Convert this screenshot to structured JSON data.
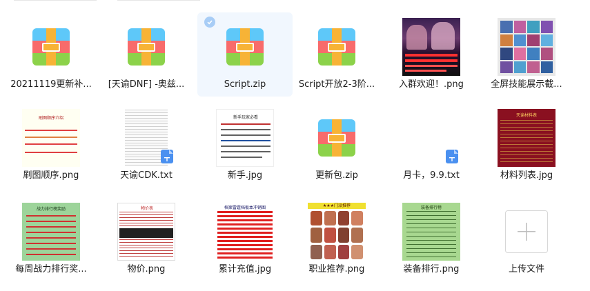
{
  "files": [
    {
      "id": "zip1",
      "name": "20211119更新补丁.zip",
      "display": "20211119更新补...",
      "kind": "zip",
      "selected": false
    },
    {
      "id": "zip2",
      "name": "[天谕DNF] -奥兹.zip",
      "display": "[天谕DNF] -奥兹...",
      "kind": "zip",
      "selected": false
    },
    {
      "id": "zip3",
      "name": "Script.zip",
      "display": "Script.zip",
      "kind": "zip",
      "selected": true
    },
    {
      "id": "zip4",
      "name": "Script开放2-3阶...",
      "display": "Script开放2-3阶...",
      "kind": "zip",
      "selected": false
    },
    {
      "id": "img1",
      "name": "入群欢迎！.png",
      "display": "入群欢迎！.png",
      "kind": "image",
      "selected": false
    },
    {
      "id": "img2",
      "name": "全屏技能展示截...",
      "display": "全屏技能展示截...",
      "kind": "image",
      "selected": false
    },
    {
      "id": "img3",
      "name": "刷图顺序.png",
      "display": "刷图顺序.png",
      "kind": "image",
      "selected": false
    },
    {
      "id": "txt1",
      "name": "天谕CDK.txt",
      "display": "天谕CDK.txt",
      "kind": "txt",
      "selected": false
    },
    {
      "id": "img4",
      "name": "新手.jpg",
      "display": "新手.jpg",
      "kind": "image",
      "selected": false
    },
    {
      "id": "zip5",
      "name": "更新包.zip",
      "display": "更新包.zip",
      "kind": "zip",
      "selected": false
    },
    {
      "id": "txt2",
      "name": "月卡，9.9.txt",
      "display": "月卡，9.9.txt",
      "kind": "txt",
      "selected": false
    },
    {
      "id": "img5",
      "name": "材料列表.jpg",
      "display": "材料列表.jpg",
      "kind": "image",
      "selected": false
    },
    {
      "id": "img6",
      "name": "每周战力排行奖...",
      "display": "每周战力排行奖...",
      "kind": "image",
      "selected": false
    },
    {
      "id": "img7",
      "name": "物价.png",
      "display": "物价.png",
      "kind": "image",
      "selected": false
    },
    {
      "id": "img8",
      "name": "累计充值.jpg",
      "display": "累计充值.jpg",
      "kind": "image",
      "selected": false
    },
    {
      "id": "img9",
      "name": "职业推荐.png",
      "display": "职业推荐.png",
      "kind": "image",
      "selected": false
    },
    {
      "id": "img10",
      "name": "装备排行.png",
      "display": "装备排行.png",
      "kind": "image",
      "selected": false
    }
  ],
  "upload": {
    "label": "上传文件"
  },
  "thumb_text": {
    "img3_title": "刷图顺序介绍",
    "img4_title": "新手玩家必看",
    "img5_title": "天谕材料表",
    "img6_title": "战力排行榜奖励",
    "img7_title": "物价表",
    "img8_title": "档案雷霆档板本冲销图",
    "img9_title": "★★★门派推荐",
    "img10_title": "装备排行榜"
  },
  "colors": {
    "accent": "#1677ff",
    "selected_bg": "#f1f7fe",
    "check": "#a8cdf6"
  }
}
